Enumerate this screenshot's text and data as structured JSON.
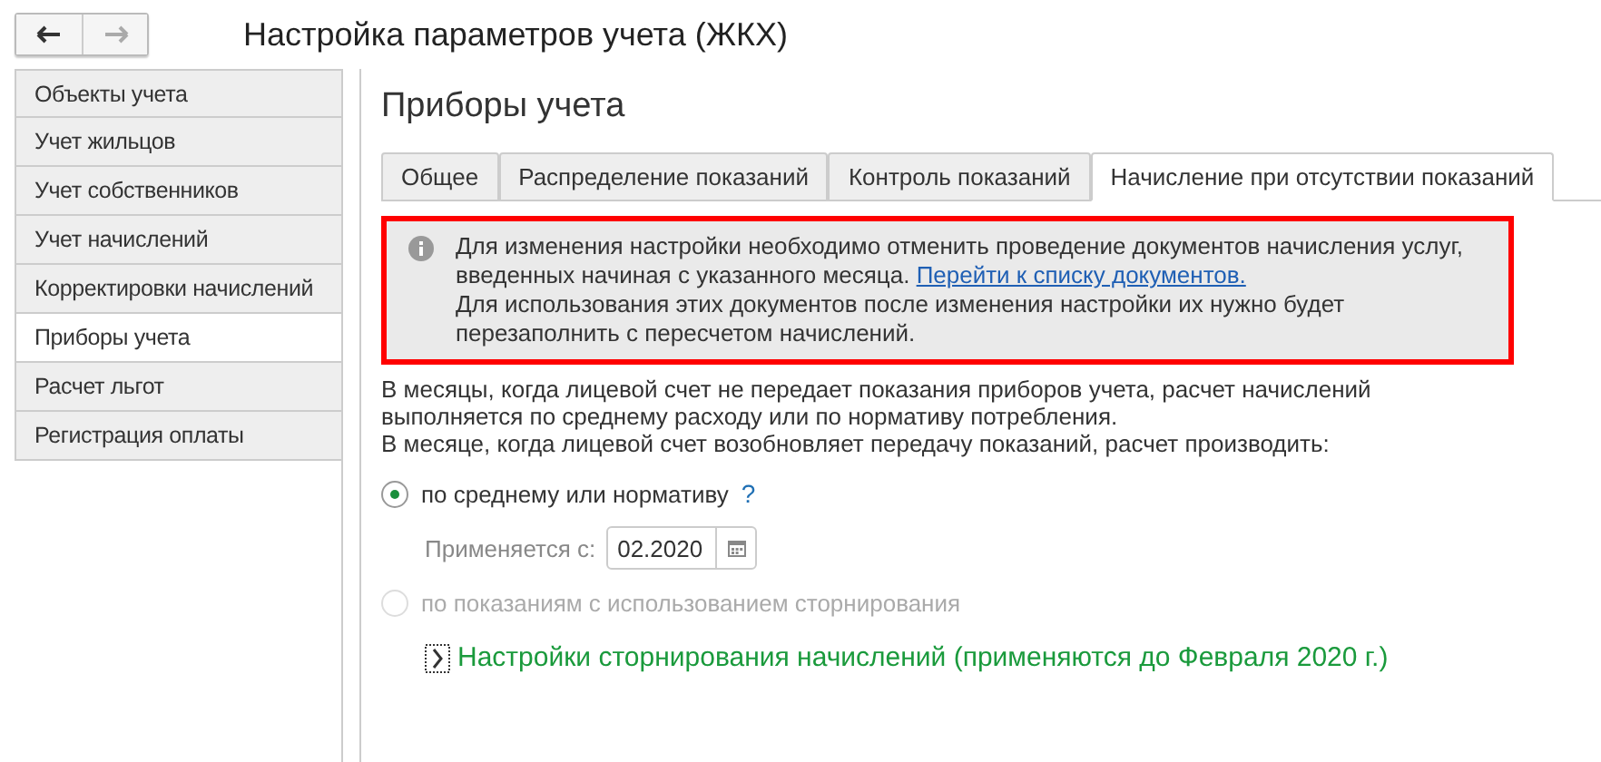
{
  "window": {
    "title": "Настройка параметров учета (ЖКХ)"
  },
  "sidebar": {
    "items": [
      {
        "label": "Объекты учета",
        "selected": false
      },
      {
        "label": "Учет жильцов",
        "selected": false
      },
      {
        "label": "Учет собственников",
        "selected": false
      },
      {
        "label": "Учет начислений",
        "selected": false
      },
      {
        "label": "Корректировки начислений",
        "selected": false
      },
      {
        "label": "Приборы учета",
        "selected": true
      },
      {
        "label": "Расчет льгот",
        "selected": false
      },
      {
        "label": "Регистрация оплаты",
        "selected": false
      }
    ]
  },
  "page": {
    "title": "Приборы учета",
    "tabs": [
      {
        "label": "Общее",
        "selected": false
      },
      {
        "label": "Распределение показаний",
        "selected": false
      },
      {
        "label": "Контроль показаний",
        "selected": false
      },
      {
        "label": "Начисление при отсутствии показаний",
        "selected": true
      }
    ],
    "info": {
      "text": "Для изменения настройки необходимо отменить проведение документов начисления услуг, введенных начиная с указанного месяца.",
      "link": "Перейти к списку документов.",
      "text_after": "Для использования этих документов после изменения настройки их нужно будет перезаполнить с пересчетом начислений."
    },
    "description": [
      "В месяцы, когда лицевой счет не передает показания приборов учета, расчет начислений выполняется по среднему расходу или по нормативу потребления.",
      "В месяце, когда лицевой счет возобновляет передачу показаний, расчет производить:"
    ],
    "options": [
      {
        "label": "по среднему или нормативу",
        "selected": true,
        "disabled": false,
        "help": "?"
      },
      {
        "label": "по показаниям с использованием сторнирования",
        "selected": false,
        "disabled": true
      }
    ],
    "applies_from": {
      "label": "Применяется с:",
      "value": "02.2020"
    },
    "storno_section": {
      "label": "Настройки сторнирования начислений (применяются до Февраля 2020 г.)",
      "expanded": false
    }
  }
}
